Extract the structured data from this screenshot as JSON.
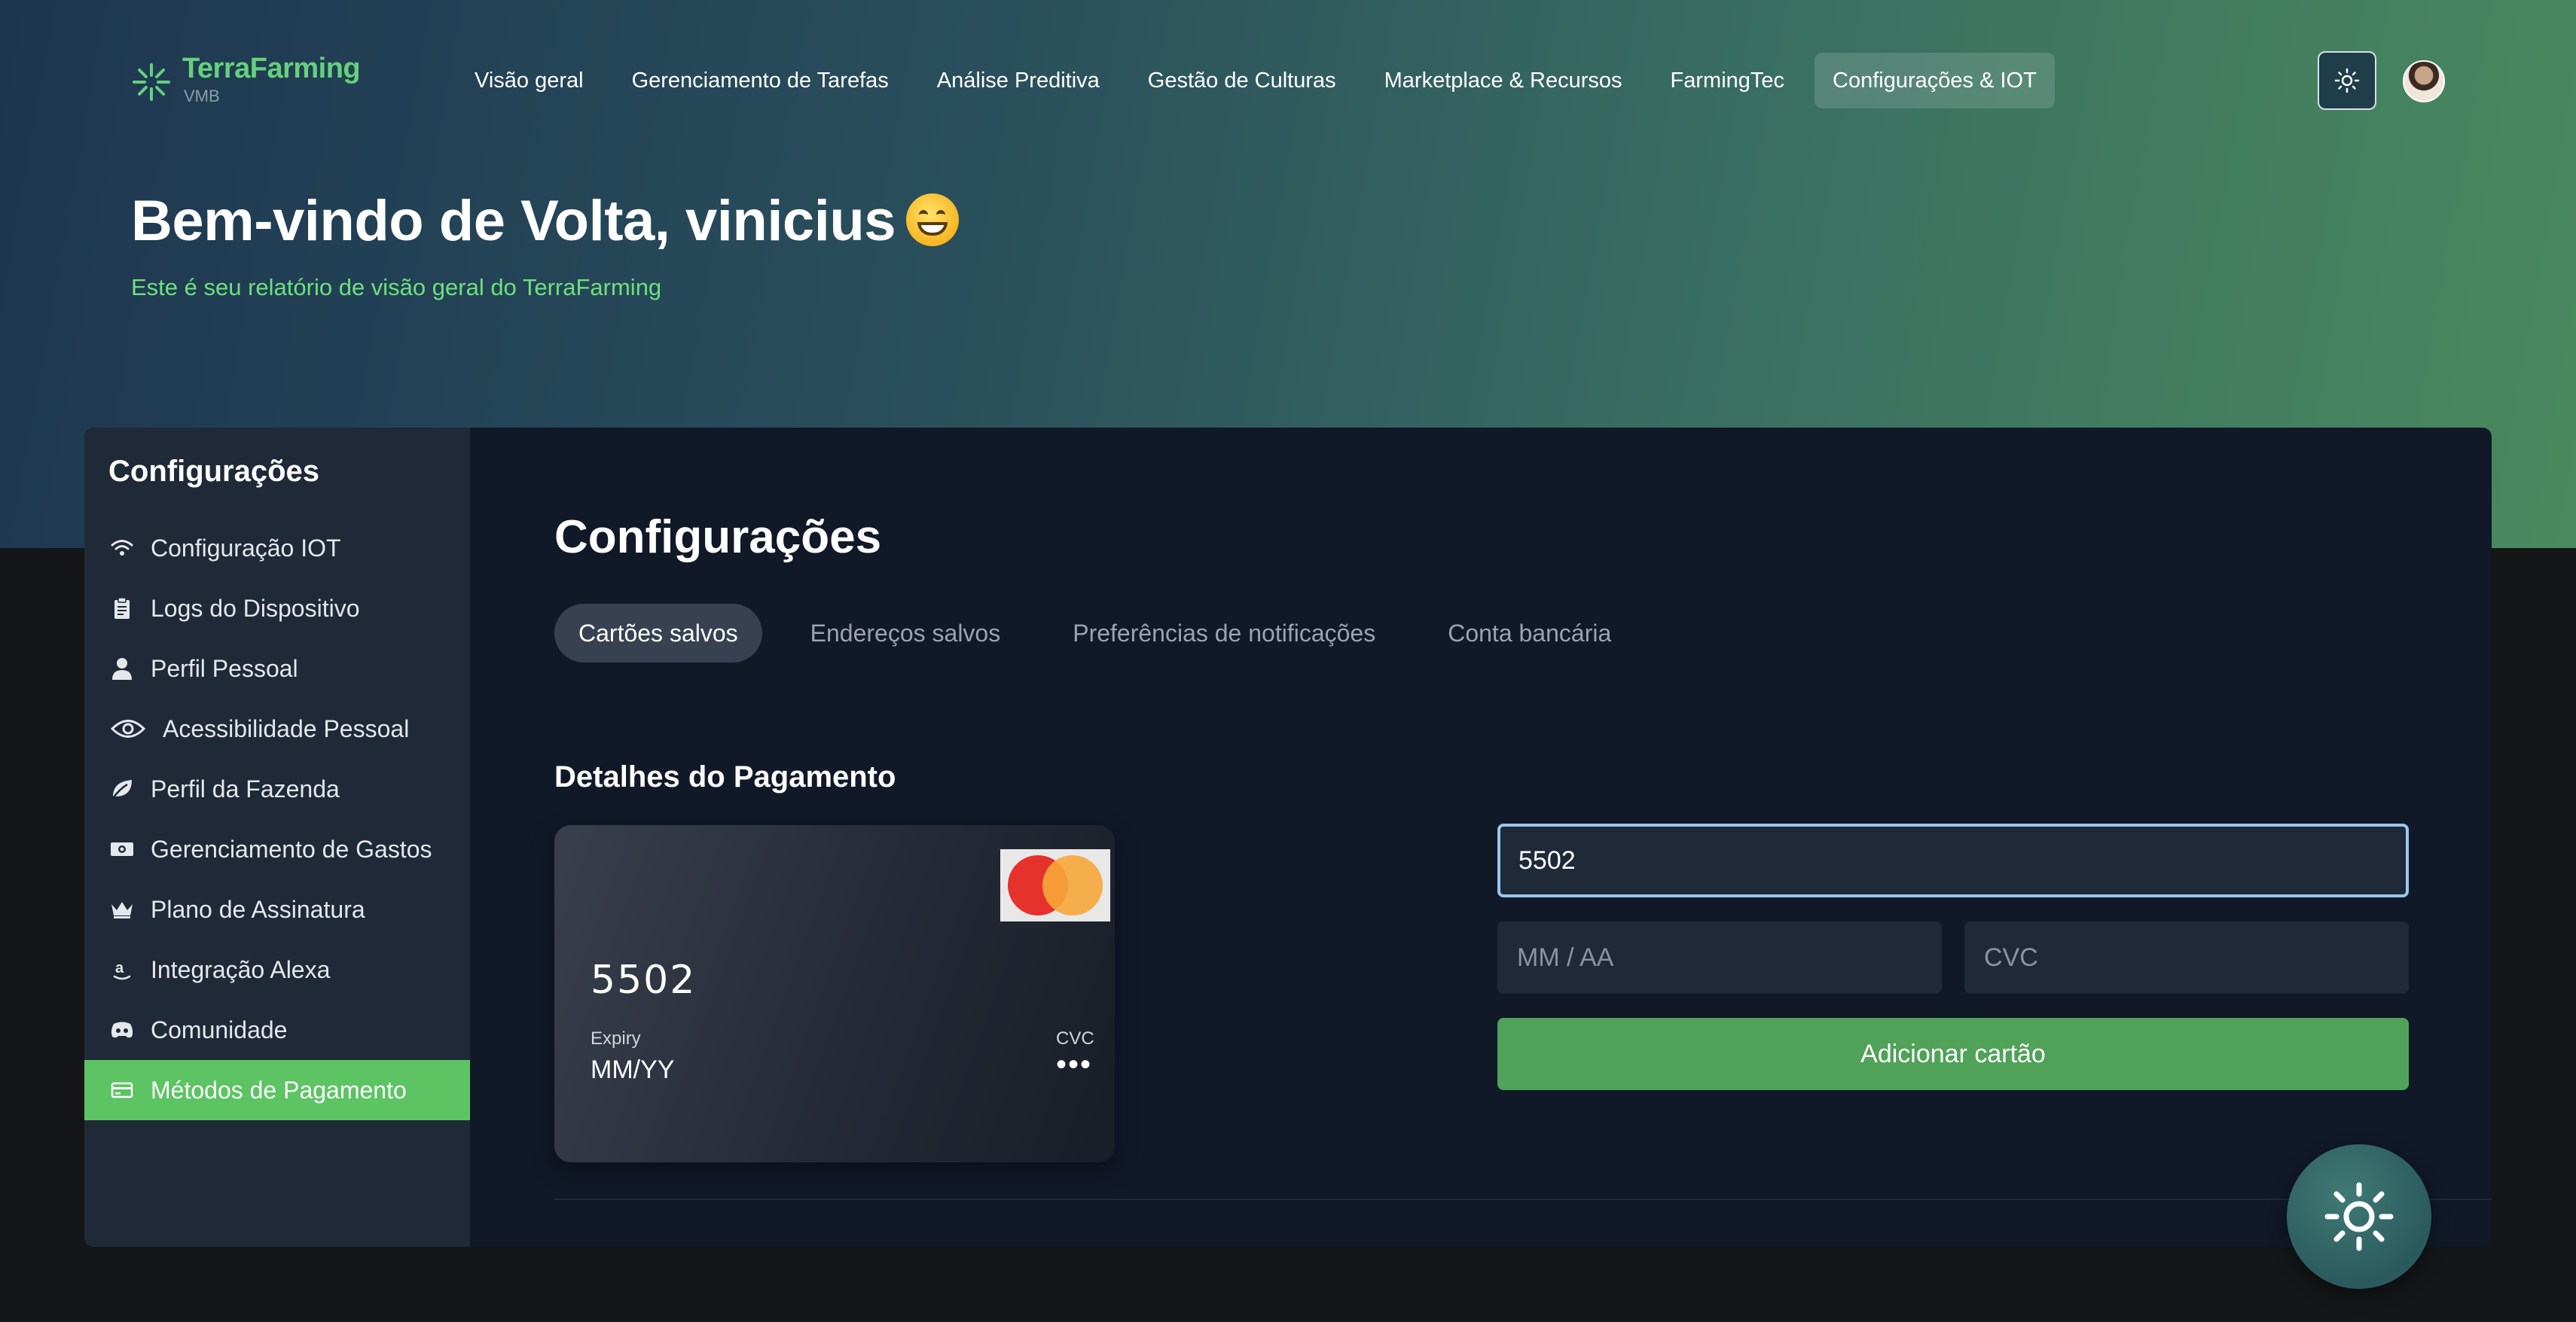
{
  "brand": {
    "name": "TerraFarming",
    "sub": "VMB"
  },
  "nav": [
    {
      "label": "Visão geral",
      "active": false
    },
    {
      "label": "Gerenciamento de Tarefas",
      "active": false
    },
    {
      "label": "Análise Preditiva",
      "active": false
    },
    {
      "label": "Gestão de Culturas",
      "active": false
    },
    {
      "label": "Marketplace & Recursos",
      "active": false
    },
    {
      "label": "FarmingTec",
      "active": false
    },
    {
      "label": "Configurações & IOT",
      "active": true
    }
  ],
  "hero": {
    "welcome": "Bem-vindo de Volta, vinicius",
    "subtitle": "Este é seu relatório de visão geral do TerraFarming"
  },
  "sidebar": {
    "title": "Configurações",
    "items": [
      {
        "label": "Configuração IOT",
        "icon": "wifi-icon"
      },
      {
        "label": "Logs do Dispositivo",
        "icon": "clipboard-icon"
      },
      {
        "label": "Perfil Pessoal",
        "icon": "user-icon"
      },
      {
        "label": "Acessibilidade Pessoal",
        "icon": "eye-icon"
      },
      {
        "label": "Perfil da Fazenda",
        "icon": "leaf-icon"
      },
      {
        "label": "Gerenciamento de Gastos",
        "icon": "money-icon"
      },
      {
        "label": "Plano de Assinatura",
        "icon": "crown-icon"
      },
      {
        "label": "Integração Alexa",
        "icon": "amazon-icon"
      },
      {
        "label": "Comunidade",
        "icon": "discord-icon"
      },
      {
        "label": "Métodos de Pagamento",
        "icon": "credit-card-icon",
        "active": true
      }
    ]
  },
  "main": {
    "title": "Configurações",
    "tabs": [
      {
        "label": "Cartões salvos",
        "active": true
      },
      {
        "label": "Endereços salvos",
        "active": false
      },
      {
        "label": "Preferências de notificações",
        "active": false
      },
      {
        "label": "Conta bancária",
        "active": false
      }
    ],
    "section_title": "Detalhes do Pagamento",
    "card": {
      "number": "5502",
      "expiry_label": "Expiry",
      "expiry_value": "MM/YY",
      "cvc_label": "CVC",
      "cvc_value": "•••"
    },
    "form": {
      "card_number_value": "5502",
      "expiry_placeholder": "MM / AA",
      "cvc_placeholder": "CVC",
      "submit_label": "Adicionar cartão"
    }
  },
  "colors": {
    "accent_green": "#5cc463",
    "button_green": "#4fa258",
    "panel_bg": "#111827",
    "sidebar_bg": "#1f2937"
  }
}
